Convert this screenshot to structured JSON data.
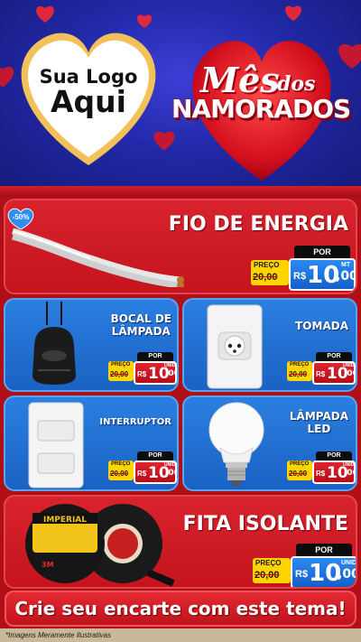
{
  "header": {
    "logo_line1": "Sua Logo",
    "logo_line2": "Aqui",
    "theme_mes": "Mês",
    "theme_dos": "dos",
    "theme_namorados": "NAMORADOS"
  },
  "discount_badge": "-50%",
  "products": [
    {
      "name": "FIO DE ENERGIA",
      "preco_label": "PREÇO",
      "old_price": "20,00",
      "por_label": "POR",
      "currency": "R$",
      "price_int": "10",
      "price_cents": ",00",
      "unit": "MT"
    },
    {
      "name_line1": "BOCAL DE",
      "name_line2": "LÂMPADA",
      "preco_label": "PREÇO",
      "old_price": "20,00",
      "por_label": "POR",
      "currency": "R$",
      "price_int": "10",
      "price_cents": ",00",
      "unit": "UNID"
    },
    {
      "name": "TOMADA",
      "preco_label": "PREÇO",
      "old_price": "20,00",
      "por_label": "POR",
      "currency": "R$",
      "price_int": "10",
      "price_cents": ",00",
      "unit": "UNID"
    },
    {
      "name": "INTERRUPTOR",
      "preco_label": "PREÇO",
      "old_price": "20,00",
      "por_label": "POR",
      "currency": "R$",
      "price_int": "10",
      "price_cents": ",00",
      "unit": "UNID"
    },
    {
      "name_line1": "LÂMPADA",
      "name_line2": "LED",
      "preco_label": "PREÇO",
      "old_price": "20,00",
      "por_label": "POR",
      "currency": "R$",
      "price_int": "10",
      "price_cents": ",00",
      "unit": "UNID"
    },
    {
      "name": "FITA ISOLANTE",
      "preco_label": "PREÇO",
      "old_price": "20,00",
      "por_label": "POR",
      "currency": "R$",
      "price_int": "10",
      "price_cents": ",00",
      "unit": "UNID",
      "brand": "IMPERIAL",
      "brand2": "3M"
    }
  ],
  "cta": "Crie seu encarte com este tema!",
  "disclaimer": "*Imagens Meramente Ilustrativas",
  "colors": {
    "header_blue": "#2229a8",
    "panel_red": "#c4141e",
    "panel_blue": "#1a62c4",
    "price_yellow": "#ffd400",
    "price_blue": "#155fc8"
  }
}
